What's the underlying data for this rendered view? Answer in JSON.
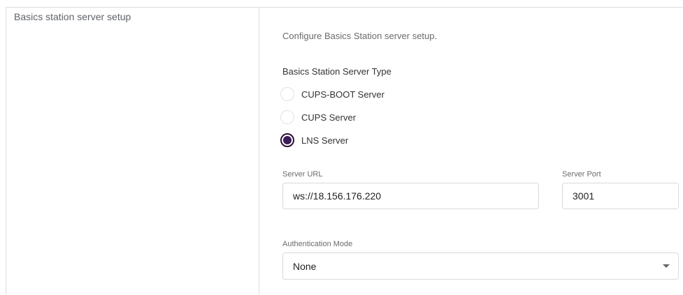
{
  "section": {
    "title": "Basics station server setup",
    "description": "Configure Basics Station server setup."
  },
  "server_type": {
    "label": "Basics Station Server Type",
    "options": [
      {
        "label": "CUPS-BOOT Server",
        "selected": false
      },
      {
        "label": "CUPS Server",
        "selected": false
      },
      {
        "label": "LNS Server",
        "selected": true
      }
    ]
  },
  "server_url": {
    "label": "Server URL",
    "value": "ws://18.156.176.220"
  },
  "server_port": {
    "label": "Server Port",
    "value": "3001"
  },
  "auth_mode": {
    "label": "Authentication Mode",
    "value": "None"
  },
  "colors": {
    "accent": "#3b1a56",
    "border": "#d9d9d9"
  }
}
